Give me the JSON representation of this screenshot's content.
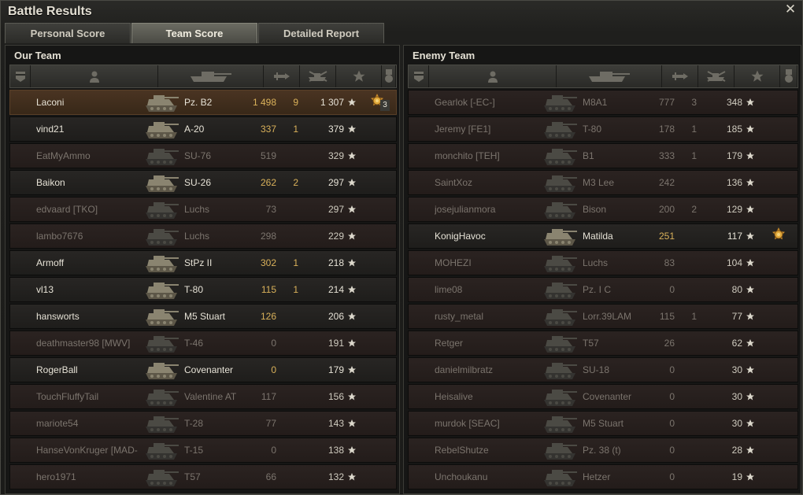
{
  "window": {
    "title": "Battle Results",
    "close_icon": "close-icon"
  },
  "tabs": [
    {
      "label": "Personal Score",
      "active": false
    },
    {
      "label": "Team Score",
      "active": true
    },
    {
      "label": "Detailed Report",
      "active": false
    }
  ],
  "our_team": {
    "title": "Our Team",
    "players": [
      {
        "name": "Laconi",
        "vehicle": "Pz. B2",
        "damage": "1 498",
        "kills": "9",
        "xp": "1 307",
        "alive": true,
        "player": true,
        "medal": "3"
      },
      {
        "name": "vind21",
        "vehicle": "A-20",
        "damage": "337",
        "kills": "1",
        "xp": "379",
        "alive": true
      },
      {
        "name": "EatMyAmmo",
        "vehicle": "SU-76",
        "damage": "519",
        "kills": "",
        "xp": "329",
        "alive": false
      },
      {
        "name": "Baikon",
        "vehicle": "SU-26",
        "damage": "262",
        "kills": "2",
        "xp": "297",
        "alive": true
      },
      {
        "name": "edvaard [TKO]",
        "vehicle": "Luchs",
        "damage": "73",
        "kills": "",
        "xp": "297",
        "alive": false
      },
      {
        "name": "lambo7676",
        "vehicle": "Luchs",
        "damage": "298",
        "kills": "",
        "xp": "229",
        "alive": false
      },
      {
        "name": "Armoff",
        "vehicle": "StPz II",
        "damage": "302",
        "kills": "1",
        "xp": "218",
        "alive": true
      },
      {
        "name": "vl13",
        "vehicle": "T-80",
        "damage": "115",
        "kills": "1",
        "xp": "214",
        "alive": true
      },
      {
        "name": "hansworts",
        "vehicle": "M5 Stuart",
        "damage": "126",
        "kills": "",
        "xp": "206",
        "alive": true
      },
      {
        "name": "deathmaster98 [MWV]",
        "vehicle": "T-46",
        "damage": "0",
        "kills": "",
        "xp": "191",
        "alive": false
      },
      {
        "name": "RogerBall",
        "vehicle": "Covenanter",
        "damage": "0",
        "kills": "",
        "xp": "179",
        "alive": true
      },
      {
        "name": "TouchFluffyTail",
        "vehicle": "Valentine AT",
        "damage": "117",
        "kills": "",
        "xp": "156",
        "alive": false
      },
      {
        "name": "mariote54",
        "vehicle": "T-28",
        "damage": "77",
        "kills": "",
        "xp": "143",
        "alive": false
      },
      {
        "name": "HanseVonKruger [MAD-",
        "vehicle": "T-15",
        "damage": "0",
        "kills": "",
        "xp": "138",
        "alive": false
      },
      {
        "name": "hero1971",
        "vehicle": "T57",
        "damage": "66",
        "kills": "",
        "xp": "132",
        "alive": false
      }
    ]
  },
  "enemy_team": {
    "title": "Enemy Team",
    "players": [
      {
        "name": "Gearlok [-EC-]",
        "vehicle": "M8A1",
        "damage": "777",
        "kills": "3",
        "xp": "348",
        "alive": false
      },
      {
        "name": "Jeremy [FE1]",
        "vehicle": "T-80",
        "damage": "178",
        "kills": "1",
        "xp": "185",
        "alive": false
      },
      {
        "name": "monchito [TEH]",
        "vehicle": "B1",
        "damage": "333",
        "kills": "1",
        "xp": "179",
        "alive": false
      },
      {
        "name": "SaintXoz",
        "vehicle": "M3 Lee",
        "damage": "242",
        "kills": "",
        "xp": "136",
        "alive": false
      },
      {
        "name": "josejulianmora",
        "vehicle": "Bison",
        "damage": "200",
        "kills": "2",
        "xp": "129",
        "alive": false
      },
      {
        "name": "KonigHavoc",
        "vehicle": "Matilda",
        "damage": "251",
        "kills": "",
        "xp": "117",
        "alive": true,
        "medal": ""
      },
      {
        "name": "MOHEZI",
        "vehicle": "Luchs",
        "damage": "83",
        "kills": "",
        "xp": "104",
        "alive": false
      },
      {
        "name": "lime08",
        "vehicle": "Pz. I C",
        "damage": "0",
        "kills": "",
        "xp": "80",
        "alive": false
      },
      {
        "name": "rusty_metal",
        "vehicle": "Lorr.39LAM",
        "damage": "115",
        "kills": "1",
        "xp": "77",
        "alive": false
      },
      {
        "name": "Retger",
        "vehicle": "T57",
        "damage": "26",
        "kills": "",
        "xp": "62",
        "alive": false
      },
      {
        "name": "danielmilbratz",
        "vehicle": "SU-18",
        "damage": "0",
        "kills": "",
        "xp": "30",
        "alive": false
      },
      {
        "name": "Heisalive",
        "vehicle": "Covenanter",
        "damage": "0",
        "kills": "",
        "xp": "30",
        "alive": false
      },
      {
        "name": "murdok [SEAC]",
        "vehicle": "M5 Stuart",
        "damage": "0",
        "kills": "",
        "xp": "30",
        "alive": false
      },
      {
        "name": "RebelShutze",
        "vehicle": "Pz. 38 (t)",
        "damage": "0",
        "kills": "",
        "xp": "28",
        "alive": false
      },
      {
        "name": "Unchoukanu",
        "vehicle": "Hetzer",
        "damage": "0",
        "kills": "",
        "xp": "19",
        "alive": false
      }
    ]
  },
  "columns": [
    "squad-icon",
    "player-icon",
    "tank-icon",
    "damage-icon",
    "kills-icon",
    "xp-star-icon",
    "medal-icon"
  ],
  "colors": {
    "damage_alive": "#d9b15a",
    "dead_text": "#7b746d",
    "player_row": "#4a3422"
  }
}
